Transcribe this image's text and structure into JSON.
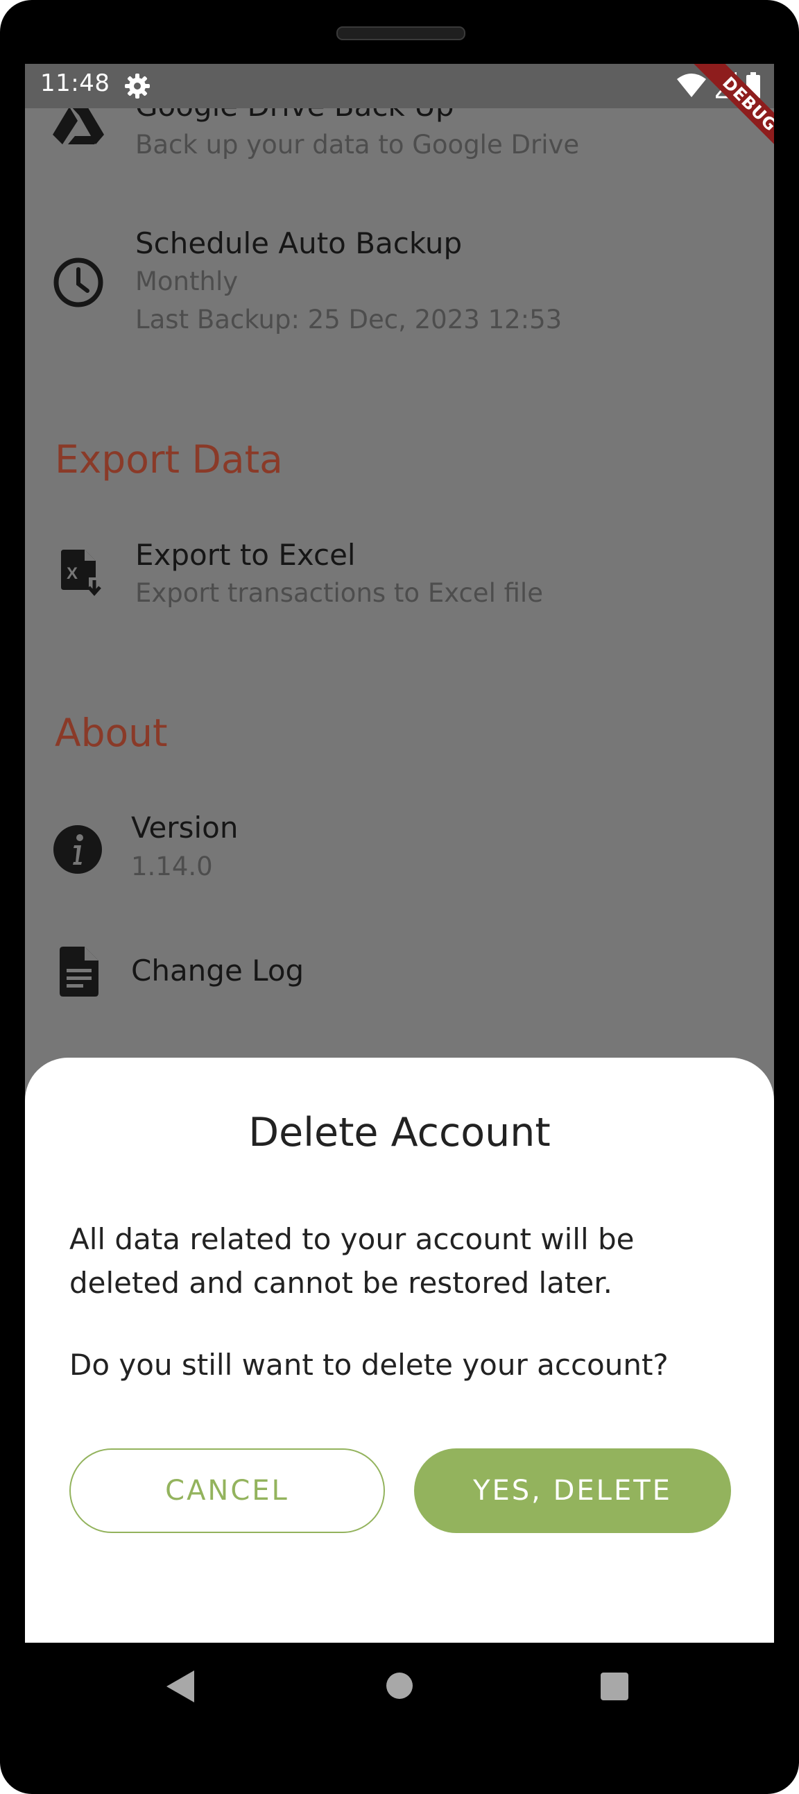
{
  "status_bar": {
    "time": "11:48",
    "debug_label": "DEBUG"
  },
  "backup": {
    "google_drive_title": "Google Drive Back Up",
    "google_drive_subtitle": "Back up your data to Google Drive",
    "schedule_title": "Schedule Auto Backup",
    "schedule_frequency": "Monthly",
    "last_backup": "Last Backup: 25 Dec, 2023 12:53"
  },
  "export": {
    "section_title": "Export Data",
    "excel_title": "Export to Excel",
    "excel_subtitle": "Export transactions to Excel file"
  },
  "about": {
    "section_title": "About",
    "version_title": "Version",
    "version_value": "1.14.0",
    "changelog_title": "Change Log"
  },
  "dialog": {
    "title": "Delete Account",
    "body": "All data related to your account will be deleted and cannot be restored later.",
    "question": "Do you still want to delete your account?",
    "cancel_label": "CANCEL",
    "confirm_label": "YES, DELETE"
  },
  "colors": {
    "accent": "#93b35d",
    "section_heading": "#8a3a28",
    "scrim": "#777777",
    "debug_banner": "#8e1d1d"
  }
}
